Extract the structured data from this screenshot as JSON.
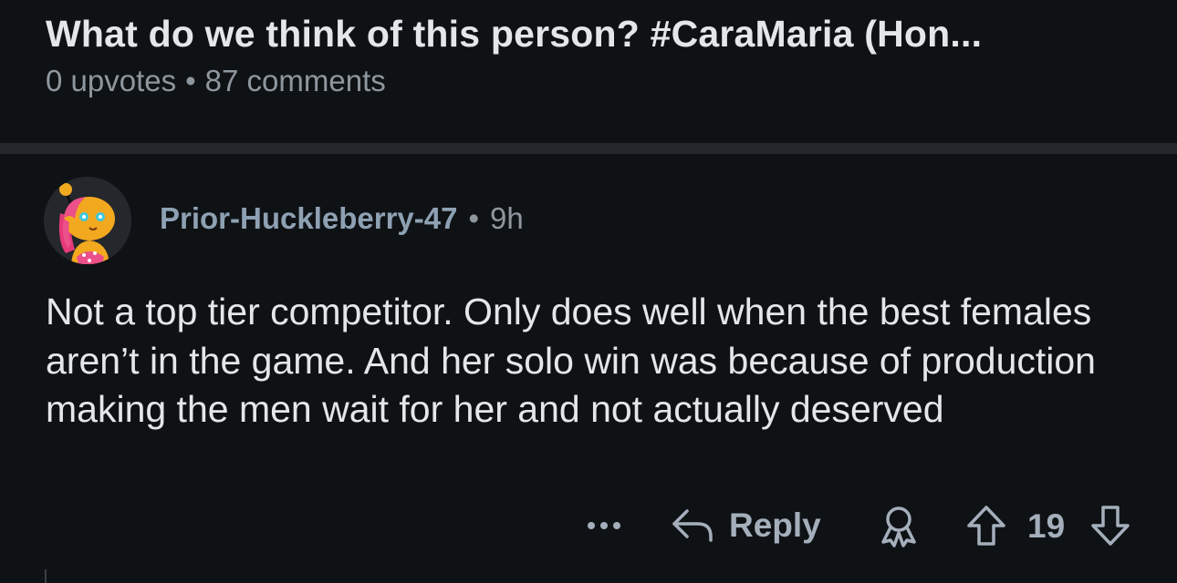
{
  "post": {
    "title": "What do we think of this person? #CaraMaria (Hon...",
    "upvotes": "0 upvotes",
    "separator": "•",
    "comments": "87 comments"
  },
  "comment": {
    "author": "Prior-Huckleberry-47",
    "separator": "•",
    "age": "9h",
    "avatar_icon": "cartoon-avatar-icon",
    "body": "Not a top tier competitor. Only does well when the best females aren’t in the game. And her solo win was because of production making the men wait for her and not actually deserved",
    "actions": {
      "more_icon": "ellipsis-icon",
      "reply_icon": "reply-arrow-icon",
      "reply_label": "Reply",
      "award_icon": "award-icon",
      "upvote_icon": "upvote-arrow-icon",
      "score": "19",
      "downvote_icon": "downvote-arrow-icon"
    }
  },
  "colors": {
    "background": "#0f1215",
    "divider": "#24272b",
    "title_text": "#e4e6e8",
    "meta_text": "#8f979e",
    "author_text": "#8ea1b3",
    "action_text": "#a4afbb"
  }
}
